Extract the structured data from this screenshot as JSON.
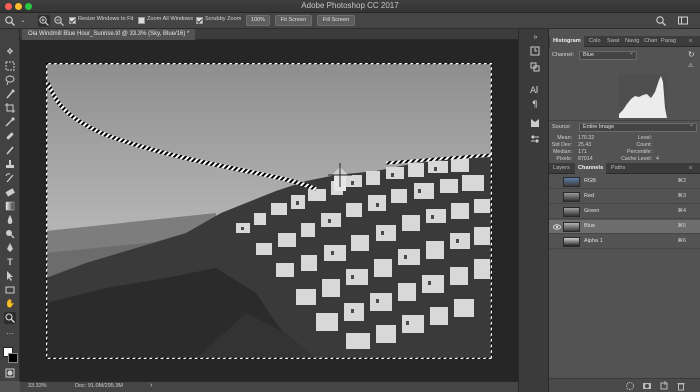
{
  "window": {
    "title": "Adobe Photoshop CC 2017",
    "traffic_colors": [
      "#ff5f57",
      "#febc2e",
      "#28c840"
    ]
  },
  "options_bar": {
    "tool_icon": "zoom-icon",
    "resize_windows_label": "Resize Windows to Fit",
    "resize_windows_checked": true,
    "zoom_all_label": "Zoom All Windows",
    "zoom_all_checked": false,
    "scrubby_zoom_label": "Scrubby Zoom",
    "scrubby_zoom_checked": true,
    "btn_100": "100%",
    "btn_fit": "Fit Screen",
    "btn_fill": "Fill Screen"
  },
  "document": {
    "tab_title": "Oia Windmill Blue Hour_Sunrise.tif @ 33.3% (Sky, Blue/16) *"
  },
  "status_bar": {
    "zoom": "33.33%",
    "doc_info": "Doc: 91.0M/295.3M",
    "arrow": "›"
  },
  "histogram_panel": {
    "tabs": [
      "Histogram",
      "Colo",
      "Swat",
      "Navig",
      "Chan",
      "Parag"
    ],
    "channel_label": "Channel:",
    "channel_value": "Blue",
    "source_label": "Source:",
    "source_value": "Entire Image",
    "stats_left": [
      {
        "label": "Mean:",
        "value": "170.32"
      },
      {
        "label": "Std Dev:",
        "value": "25.43"
      },
      {
        "label": "Median:",
        "value": "171"
      },
      {
        "label": "Pixels:",
        "value": "87014"
      }
    ],
    "stats_right": [
      {
        "label": "Level:",
        "value": ""
      },
      {
        "label": "Count:",
        "value": ""
      },
      {
        "label": "Percentile:",
        "value": ""
      },
      {
        "label": "Cache Level:",
        "value": "4"
      }
    ]
  },
  "channels_panel": {
    "tabs": [
      "Layers",
      "Channels",
      "Paths"
    ],
    "rows": [
      {
        "name": "RGB",
        "shortcut": "⌘2",
        "visible": false,
        "selected": false,
        "thumb": "#5d7fa8"
      },
      {
        "name": "Red",
        "shortcut": "⌘3",
        "visible": false,
        "selected": false,
        "thumb": "#6a6a6a"
      },
      {
        "name": "Green",
        "shortcut": "⌘4",
        "visible": false,
        "selected": false,
        "thumb": "#707070"
      },
      {
        "name": "Blue",
        "shortcut": "⌘5",
        "visible": true,
        "selected": true,
        "thumb": "#8a8a8a"
      },
      {
        "name": "Alpha 1",
        "shortcut": "⌘6",
        "visible": false,
        "selected": false,
        "thumb": "#555555"
      }
    ]
  }
}
